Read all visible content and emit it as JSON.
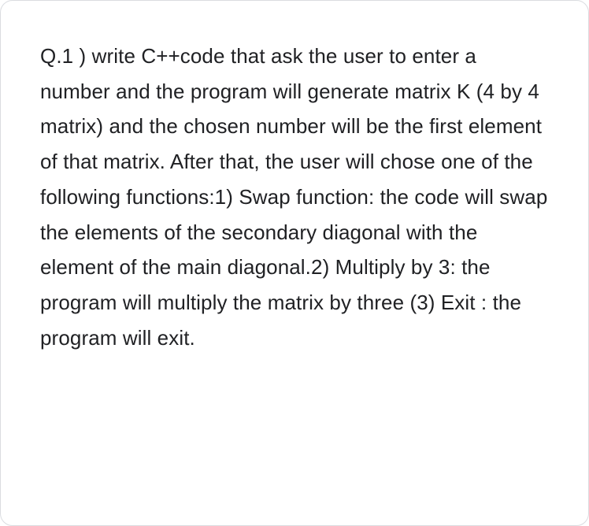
{
  "question": {
    "text": "Q.1 ) write C++code that ask the user to enter a number and the program will generate matrix K (4 by 4 matrix) and the chosen number will be the first element of that matrix. After that, the user will chose one of the following functions:1) Swap function: the code will swap the elements of the secondary diagonal with the element of the main diagonal.2) Multiply by 3: the program will multiply the matrix by three (3) Exit : the program will exit."
  }
}
